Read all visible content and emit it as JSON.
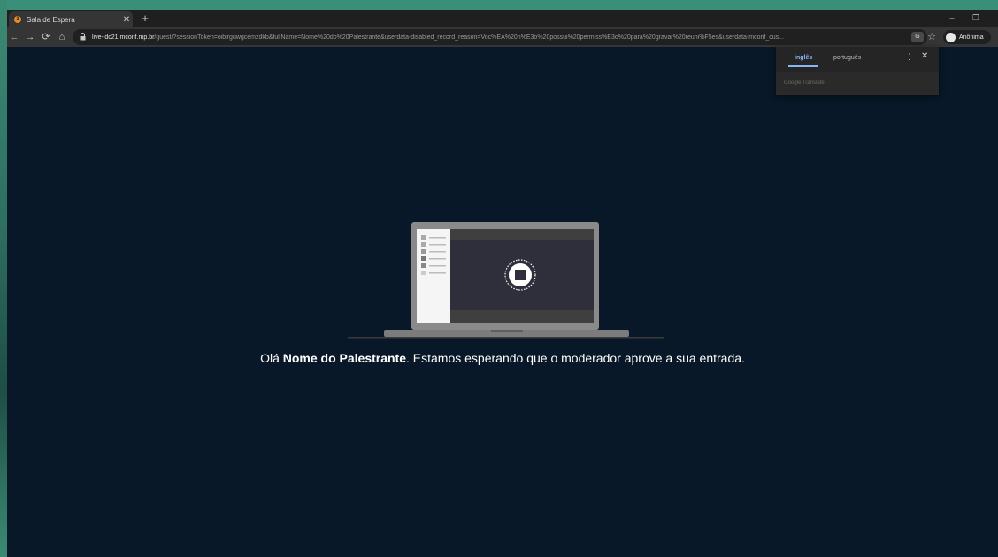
{
  "browser": {
    "tab": {
      "title": "Sala de Espera",
      "favicon": "3"
    },
    "url": {
      "host": "live-idc21.mconf.mp.br",
      "rest": "/guest/?sessionToken=oibirguwgcemzdkb&fullName=Nome%20do%20Palestrante&userdata-disabled_record_reason=Voc%EA%20n%E3o%20possui%20permiss%E3o%20para%20gravar%20reuni%F5es&userdata-mconf_cus..."
    },
    "profile_label": "Anônima"
  },
  "translate": {
    "tab_source": "inglês",
    "tab_target": "português",
    "footer": "Google Translate"
  },
  "page": {
    "greeting": "Olá",
    "name": "Nome do Palestrante",
    "message": ". Estamos esperando que o moderador aprove a sua entrada."
  },
  "colors": {
    "background": "#081828",
    "accent": "#8ab4f8"
  }
}
